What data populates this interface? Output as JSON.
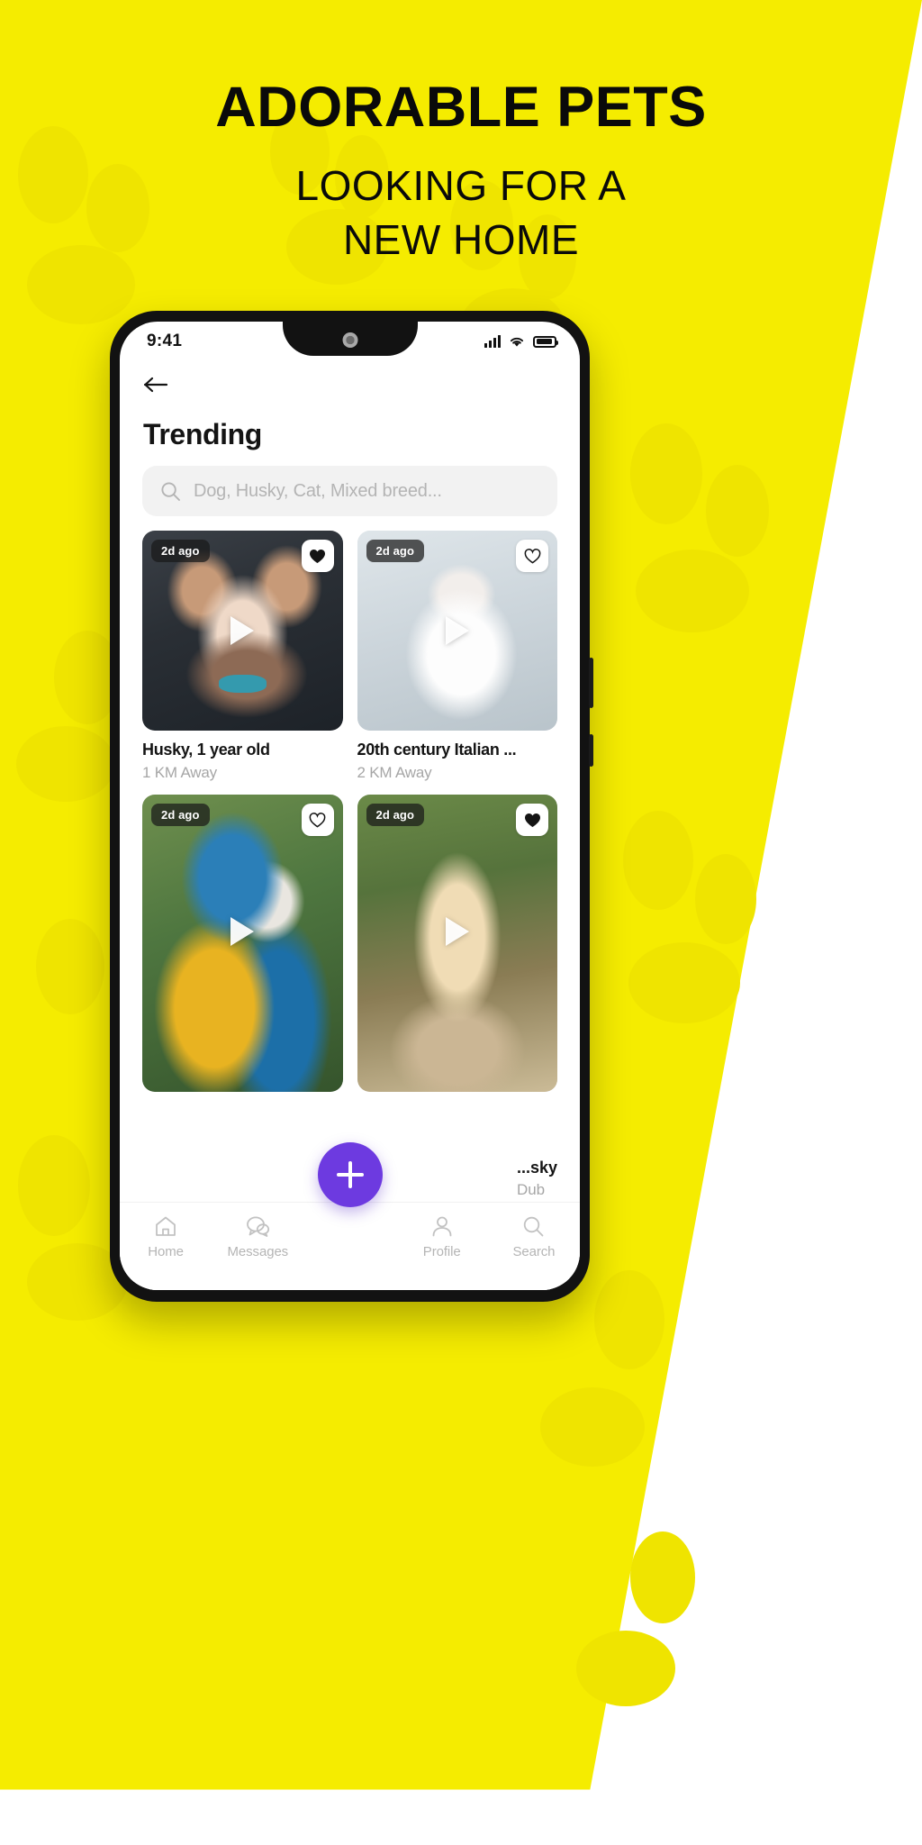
{
  "poster": {
    "headline": "ADORABLE PETS",
    "subheadline_line1": "LOOKING FOR A",
    "subheadline_line2": "NEW HOME",
    "background_color": "#f5ec00",
    "text_color": "#0a0a0a"
  },
  "phone": {
    "statusbar": {
      "time": "9:41",
      "signal_icon": "cellular-signal-icon",
      "wifi_icon": "wifi-icon",
      "battery_icon": "battery-icon"
    }
  },
  "app": {
    "back_icon": "back-arrow-icon",
    "title": "Trending",
    "search": {
      "icon": "search-icon",
      "placeholder": "Dog, Husky, Cat, Mixed breed...",
      "value": ""
    },
    "cards": [
      {
        "badge": "2d ago",
        "title": "Husky, 1 year old",
        "distance": "1 KM Away",
        "favorited": true,
        "image": "husky-dog-photo",
        "play_icon": "play-icon",
        "heart_icon": "heart-filled-icon"
      },
      {
        "badge": "2d ago",
        "title": "20th century Italian ...",
        "distance": "2 KM Away",
        "favorited": false,
        "image": "white-kitten-photo",
        "play_icon": "play-icon",
        "heart_icon": "heart-outline-icon"
      },
      {
        "badge": "2d ago",
        "title": "...sky",
        "distance": "Dub",
        "favorited": false,
        "image": "macaw-parrot-photo",
        "play_icon": "play-icon",
        "heart_icon": "heart-outline-icon"
      },
      {
        "badge": "2d ago",
        "title": "",
        "distance": "",
        "favorited": true,
        "image": "golden-retriever-photo",
        "play_icon": "play-icon",
        "heart_icon": "heart-filled-icon"
      }
    ],
    "fab": {
      "icon": "plus-icon",
      "color": "#6d3ae0",
      "label": "+"
    },
    "bottom_nav": [
      {
        "label": "Home",
        "icon": "home-icon"
      },
      {
        "label": "Messages",
        "icon": "chat-bubbles-icon"
      },
      {
        "label": "Profile",
        "icon": "person-icon"
      },
      {
        "label": "Search",
        "icon": "search-icon"
      }
    ]
  }
}
